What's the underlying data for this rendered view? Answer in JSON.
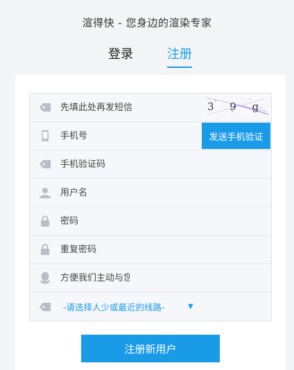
{
  "header": {
    "subtitle": "渲得快 - 您身边的渲染专家"
  },
  "tabs": [
    {
      "label": "登录",
      "active": false
    },
    {
      "label": "注册",
      "active": true
    }
  ],
  "form": {
    "captcha_placeholder": "先填此处再发短信",
    "captcha_text": "3 9 g",
    "phone_placeholder": "手机号",
    "send_sms_label": "发送手机验证",
    "sms_code_placeholder": "手机验证码",
    "username_placeholder": "用户名",
    "password_placeholder": "密码",
    "confirm_password_placeholder": "重复密码",
    "qq_placeholder": "方便我们主动与您",
    "route_selected": "-请选择人少或最近的线路-",
    "submit_label": "注册新用户"
  },
  "colors": {
    "accent": "#1a9be8",
    "icon": "#b9bdc4"
  }
}
